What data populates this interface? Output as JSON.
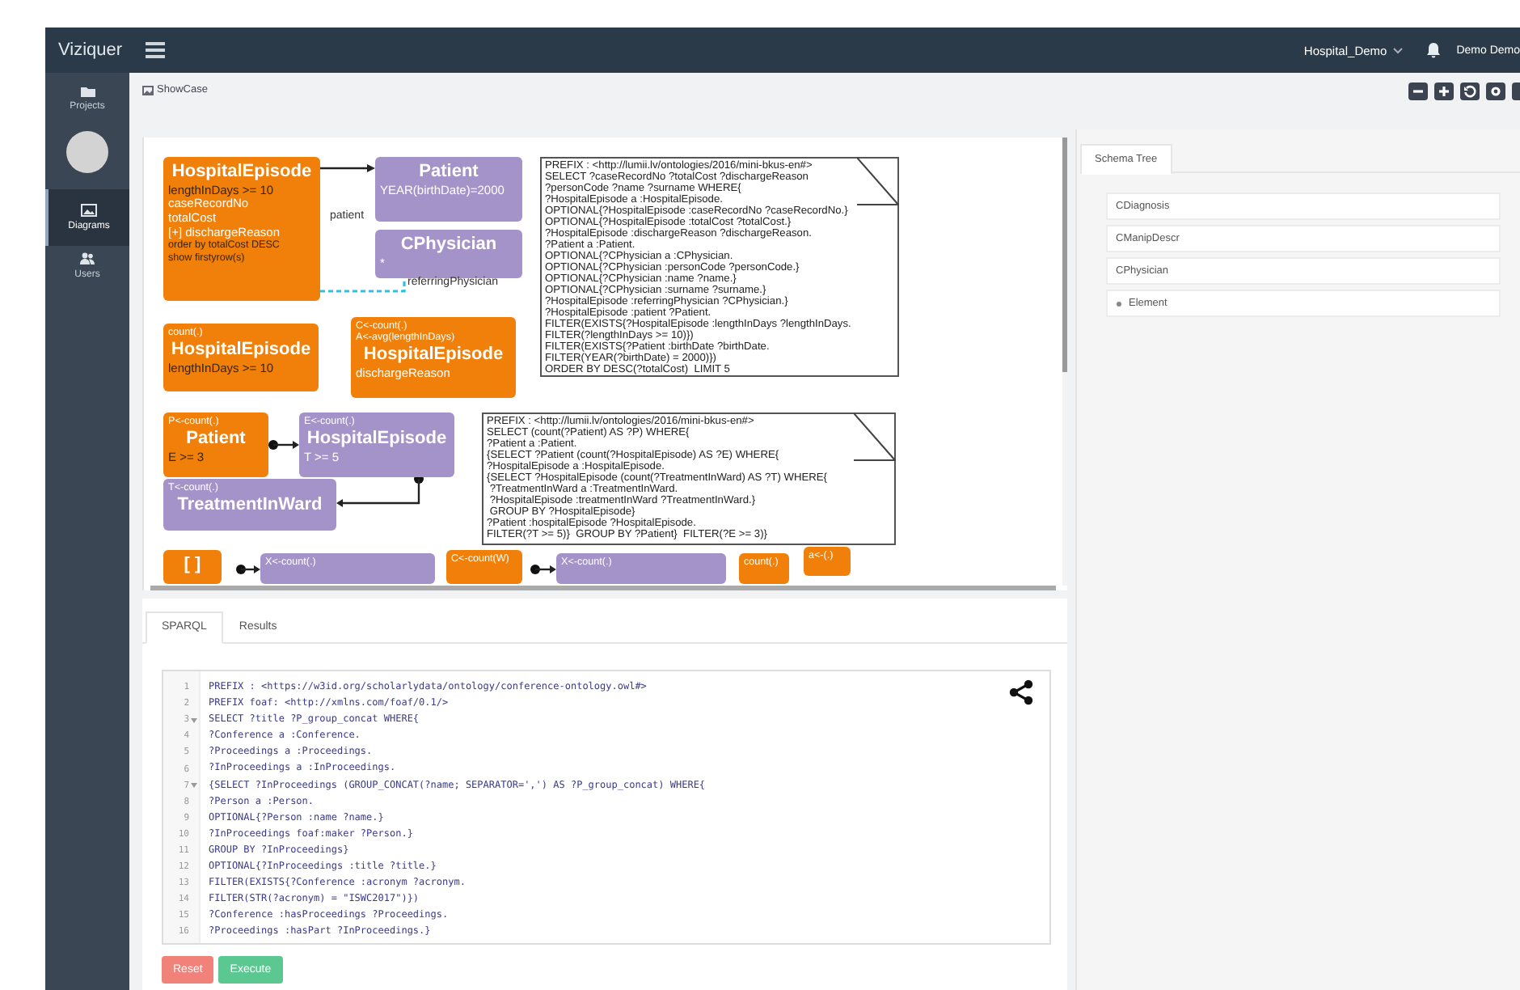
{
  "app": {
    "title": "Viziquer",
    "project_menu": "Hospital_Demo",
    "user_menu": "Demo Demo"
  },
  "sidebar": {
    "items": [
      {
        "label": "Projects",
        "selected": false
      },
      {
        "label": "Diagrams",
        "selected": true
      },
      {
        "label": "Users",
        "selected": false
      }
    ]
  },
  "breadcrumb": "ShowCase",
  "diagram": {
    "nodes": [
      {
        "color": "#f0800a",
        "lines": [
          {
            "text": "HospitalEpisode",
            "kind": "title"
          },
          {
            "text": "lengthInDays >= 10",
            "kind": "condition"
          },
          {
            "text": "caseRecordNo",
            "kind": "field"
          },
          {
            "text": "totalCost",
            "kind": "field"
          },
          {
            "text": "[+] dischargeReason",
            "kind": "field"
          },
          {
            "text": "order by totalCost DESC",
            "kind": "modifier"
          },
          {
            "text": "show firstyrow(s)",
            "kind": "modifier"
          }
        ]
      },
      {
        "color": "#a493c9",
        "lines": [
          {
            "text": "Patient",
            "kind": "title"
          },
          {
            "text": "YEAR(birthDate)=2000",
            "kind": "field"
          }
        ]
      },
      {
        "color": "#a493c9",
        "lines": [
          {
            "text": "CPhysician",
            "kind": "title"
          },
          {
            "text": "*",
            "kind": "field"
          }
        ]
      },
      {
        "color": "#f0800a",
        "lines": [
          {
            "text": "count(.)",
            "kind": "header"
          },
          {
            "text": "HospitalEpisode",
            "kind": "title"
          },
          {
            "text": "lengthInDays >= 10",
            "kind": "condition"
          }
        ]
      },
      {
        "color": "#f0800a",
        "lines": [
          {
            "text": "C<-count(.)",
            "kind": "header"
          },
          {
            "text": "A<-avg(lengthInDays)",
            "kind": "header"
          },
          {
            "text": "HospitalEpisode",
            "kind": "title"
          },
          {
            "text": "dischargeReason",
            "kind": "field"
          }
        ]
      },
      {
        "color": "#f0800a",
        "lines": [
          {
            "text": "P<-count(.)",
            "kind": "header"
          },
          {
            "text": "Patient",
            "kind": "title"
          },
          {
            "text": "E >= 3",
            "kind": "condition"
          }
        ]
      },
      {
        "color": "#a493c9",
        "lines": [
          {
            "text": "E<-count(.)",
            "kind": "header"
          },
          {
            "text": "HospitalEpisode",
            "kind": "title"
          },
          {
            "text": "T >= 5",
            "kind": "field"
          }
        ]
      },
      {
        "color": "#a493c9",
        "lines": [
          {
            "text": "T<-count(.)",
            "kind": "header"
          },
          {
            "text": "TreatmentInWard",
            "kind": "title"
          }
        ]
      },
      {
        "color": "#f0800a",
        "lines": [
          {
            "text": "[ ]",
            "kind": "title"
          }
        ]
      },
      {
        "color": "#a493c9",
        "lines": [
          {
            "text": "X<-count(.)",
            "kind": "header"
          }
        ]
      },
      {
        "color": "#f0800a",
        "lines": [
          {
            "text": "C<-count(W)",
            "kind": "header"
          }
        ]
      },
      {
        "color": "#a493c9",
        "lines": [
          {
            "text": "X<-count(.)",
            "kind": "header"
          }
        ]
      },
      {
        "color": "#f0800a",
        "lines": [
          {
            "text": "count(.)",
            "kind": "header"
          }
        ]
      },
      {
        "color": "#f0800a",
        "lines": [
          {
            "text": "a<-(.)",
            "kind": "header"
          }
        ]
      }
    ],
    "edge_labels": [
      "patient",
      "referringPhysician"
    ],
    "notes": [
      [
        "PREFIX : <http://lumii.lv/ontologies/2016/mini-bkus-en#>",
        "SELECT ?caseRecordNo ?totalCost ?dischargeReason",
        "?personCode ?name ?surname WHERE{",
        "?HospitalEpisode a :HospitalEpisode.",
        "OPTIONAL{?HospitalEpisode :caseRecordNo ?caseRecordNo.}",
        "OPTIONAL{?HospitalEpisode :totalCost ?totalCost.}",
        "?HospitalEpisode :dischargeReason ?dischargeReason.",
        "?Patient a :Patient.",
        "OPTIONAL{?CPhysician a :CPhysician.",
        "OPTIONAL{?CPhysician :personCode ?personCode.}",
        "OPTIONAL{?CPhysician :name ?name.}",
        "OPTIONAL{?CPhysician :surname ?surname.}",
        "?HospitalEpisode :referringPhysician ?CPhysician.}",
        "?HospitalEpisode :patient ?Patient.",
        "FILTER(EXISTS{?HospitalEpisode :lengthInDays ?lengthInDays.",
        "FILTER(?lengthInDays >= 10)})",
        "FILTER(EXISTS{?Patient :birthDate ?birthDate.",
        "FILTER(YEAR(?birthDate) = 2000)})",
        "ORDER BY DESC(?totalCost)  LIMIT 5"
      ],
      [
        "PREFIX : <http://lumii.lv/ontologies/2016/mini-bkus-en#>",
        "SELECT (count(?Patient) AS ?P) WHERE{",
        "?Patient a :Patient.",
        "{SELECT ?Patient (count(?HospitalEpisode) AS ?E) WHERE{",
        "?HospitalEpisode a :HospitalEpisode.",
        "{SELECT ?HospitalEpisode (count(?TreatmentInWard) AS ?T) WHERE{",
        " ?TreatmentInWard a :TreatmentInWard.",
        " ?HospitalEpisode :treatmentInWard ?TreatmentInWard.}",
        " GROUP BY ?HospitalEpisode}",
        "?Patient :hospitalEpisode ?HospitalEpisode.",
        "FILTER(?T >= 5)}  GROUP BY ?Patient}  FILTER(?E >= 3)}"
      ]
    ]
  },
  "query_tabs": [
    {
      "label": "SPARQL",
      "selected": true
    },
    {
      "label": "Results",
      "selected": false
    }
  ],
  "code": [
    {
      "number": "1",
      "text": "PREFIX : <https://w3id.org/scholarlydata/ontology/conference-ontology.owl#>",
      "foldable": false
    },
    {
      "number": "2",
      "text": "PREFIX foaf: <http://xmlns.com/foaf/0.1/>",
      "foldable": false
    },
    {
      "number": "3",
      "text": "SELECT ?title ?P_group_concat WHERE{",
      "foldable": true
    },
    {
      "number": "4",
      "text": "?Conference a :Conference.",
      "foldable": false
    },
    {
      "number": "5",
      "text": "?Proceedings a :Proceedings.",
      "foldable": false
    },
    {
      "number": "6",
      "text": "?InProceedings a :InProceedings.",
      "foldable": false
    },
    {
      "number": "7",
      "text": "{SELECT ?InProceedings (GROUP_CONCAT(?name; SEPARATOR=',') AS ?P_group_concat) WHERE{",
      "foldable": true
    },
    {
      "number": "8",
      "text": "?Person a :Person.",
      "foldable": false
    },
    {
      "number": "9",
      "text": "OPTIONAL{?Person :name ?name.}",
      "foldable": false
    },
    {
      "number": "10",
      "text": "?InProceedings foaf:maker ?Person.}",
      "foldable": false
    },
    {
      "number": "11",
      "text": "GROUP BY ?InProceedings}",
      "foldable": false
    },
    {
      "number": "12",
      "text": "OPTIONAL{?InProceedings :title ?title.}",
      "foldable": false
    },
    {
      "number": "13",
      "text": "FILTER(EXISTS{?Conference :acronym ?acronym.",
      "foldable": false
    },
    {
      "number": "14",
      "text": "FILTER(STR(?acronym) = \"ISWC2017\")})",
      "foldable": false
    },
    {
      "number": "15",
      "text": "?Conference :hasProceedings ?Proceedings.",
      "foldable": false
    },
    {
      "number": "16",
      "text": "?Proceedings :hasPart ?InProceedings.}",
      "foldable": false
    }
  ],
  "buttons": [
    {
      "label": "Reset",
      "kind": "danger"
    },
    {
      "label": "Execute",
      "kind": "success"
    }
  ],
  "schema_tree": {
    "tab": "Schema Tree",
    "items": [
      {
        "label": "CDiagnosis",
        "expandable": false
      },
      {
        "label": "CManipDescr",
        "expandable": false
      },
      {
        "label": "CPhysician",
        "expandable": false
      },
      {
        "label": "Element",
        "expandable": true
      }
    ]
  }
}
